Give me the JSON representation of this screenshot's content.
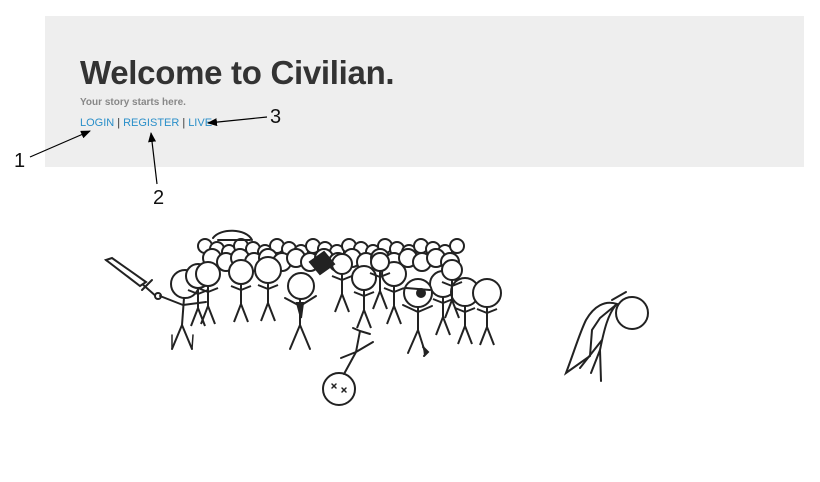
{
  "hero": {
    "title": "Welcome to Civilian.",
    "tagline": "Your story starts here.",
    "nav": {
      "login": "LOGIN",
      "register": "REGISTER",
      "live": "LIVE",
      "separator": "|"
    }
  },
  "callouts": [
    "1",
    "2",
    "3"
  ],
  "colors": {
    "hero_background": "#eeeeee",
    "title": "#333333",
    "tagline": "#888888",
    "link": "#2a8fc9"
  },
  "illustration": {
    "icon": "stick-figure-crowd-drawing"
  }
}
